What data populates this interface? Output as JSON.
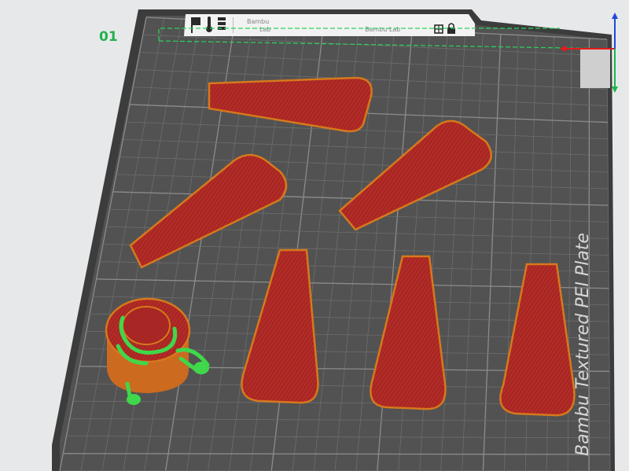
{
  "plate": {
    "number": "01",
    "label": "Bambu Textured PEI Plate",
    "header_text_1": "Bambu",
    "header_text_2": "Lab",
    "header_text_3": "Bambu Lab"
  },
  "colors": {
    "background": "#e7e8ea",
    "plate_surface": "#525252",
    "plate_frame": "#3c3c3c",
    "grid": "#7e7e7e",
    "part_fill": "#b32b27",
    "part_edge": "#d6791c",
    "support_green": "#3fd84a",
    "axis_x": "#e31b1b",
    "axis_y": "#18b84a",
    "axis_z": "#2048d8"
  },
  "icons": {
    "header": [
      "flag-icon",
      "temperature-icon",
      "plate-type-icon"
    ],
    "right": [
      "grid-icon",
      "lock-icon"
    ]
  }
}
